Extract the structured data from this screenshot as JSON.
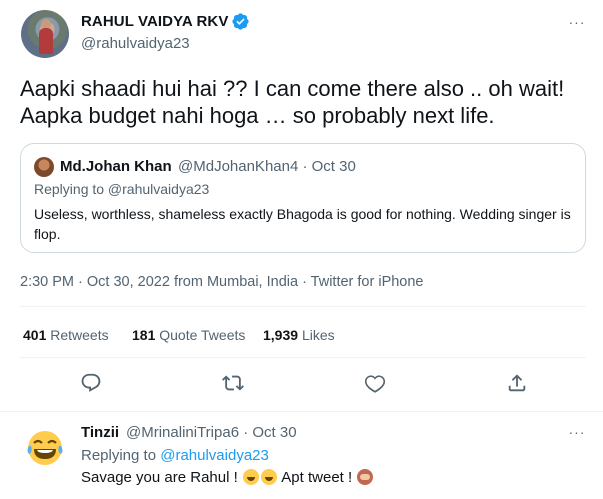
{
  "tweet": {
    "author_name": "RAHUL VAIDYA RKV",
    "author_handle": "@rahulvaidya23",
    "more_label": "···",
    "text": "Aapki shaadi hui hai ?? I can come there also .. oh wait! Aapka budget nahi hoga … so probably next life.",
    "quote": {
      "author_name": "Md.Johan Khan",
      "meta": "@MdJohanKhan4 · Oct 30",
      "replying_to": "Replying to @rahulvaidya23",
      "text": "Useless, worthless, shameless exactly Bhagoda  is good for nothing. Wedding singer is flop."
    },
    "timestamp": "2:30 PM · Oct 30, 2022 from Mumbai, India · Twitter for iPhone",
    "stats": {
      "retweets_count": "401",
      "retweets_label": "Retweets",
      "quotes_count": "181",
      "quotes_label": "Quote Tweets",
      "likes_count": "1,939",
      "likes_label": "Likes"
    },
    "actions": [
      "reply-icon",
      "retweet-icon",
      "like-icon",
      "share-icon"
    ]
  },
  "reply": {
    "author_name": "Tinzii",
    "meta": "@MrinaliniTripa6 · Oct 30",
    "more_label": "···",
    "replying_prefix": "Replying to ",
    "replying_handle": "@rahulvaidya23",
    "text_before": "Savage you are Rahul !",
    "text_middle": "Apt tweet !",
    "avatar_icon": "laughing-emoji-icon"
  },
  "colors": {
    "text_primary": "#0f1419",
    "text_secondary": "#536471",
    "link": "#1d9bf0",
    "border": "#cfd9de",
    "verified": "#1d9bf0"
  }
}
